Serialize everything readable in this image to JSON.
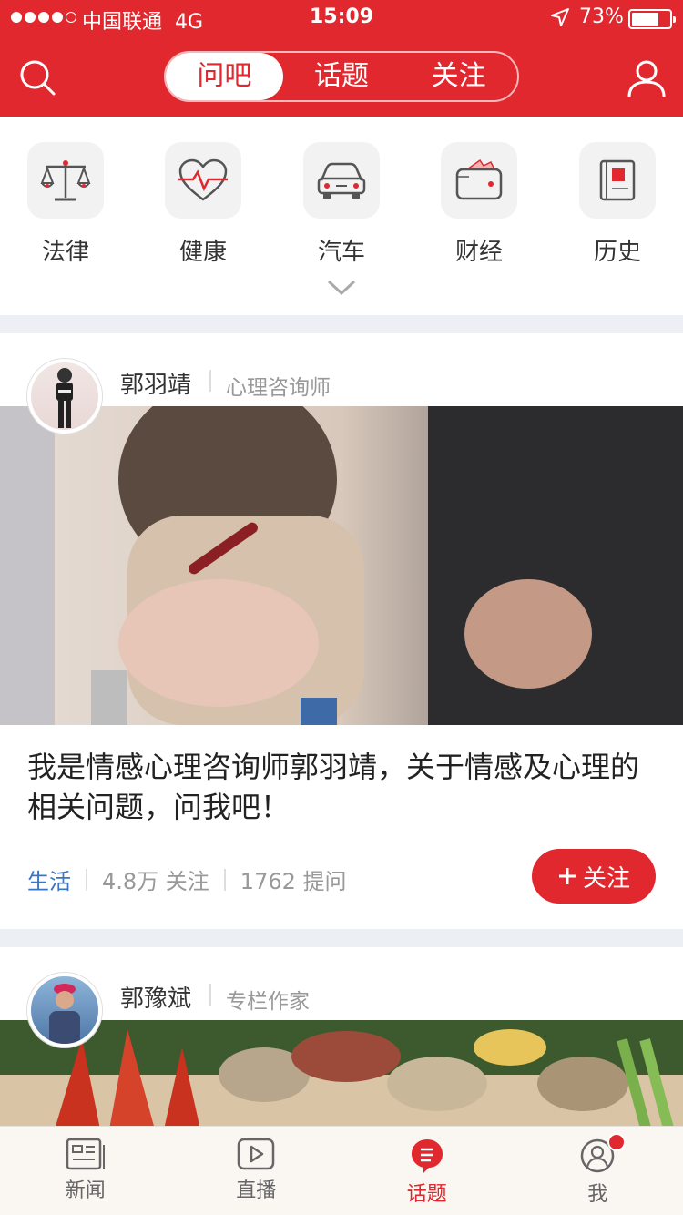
{
  "status": {
    "carrier": "中国联通",
    "network": "4G",
    "time": "15:09",
    "battery": "73%",
    "battery_level": 0.73
  },
  "nav": {
    "tabs": [
      {
        "label": "问吧",
        "active": true
      },
      {
        "label": "话题",
        "active": false
      },
      {
        "label": "关注",
        "active": false
      }
    ]
  },
  "categories": [
    {
      "label": "法律",
      "icon": "scales-icon"
    },
    {
      "label": "健康",
      "icon": "heart-pulse-icon"
    },
    {
      "label": "汽车",
      "icon": "car-icon"
    },
    {
      "label": "财经",
      "icon": "wallet-icon"
    },
    {
      "label": "历史",
      "icon": "book-icon"
    }
  ],
  "cards": [
    {
      "name": "郭羽靖",
      "role": "心理咨询师",
      "title": "我是情感心理咨询师郭羽靖，关于情感及心理的相关问题，问我吧！",
      "tag": "生活",
      "followers": "4.8万 关注",
      "questions": "1762 提问",
      "follow_label": "关注"
    },
    {
      "name": "郭豫斌",
      "role": "专栏作家"
    }
  ],
  "tabbar": [
    {
      "label": "新闻",
      "icon": "newspaper-icon",
      "active": false
    },
    {
      "label": "直播",
      "icon": "play-icon",
      "active": false
    },
    {
      "label": "话题",
      "icon": "chat-icon",
      "active": true
    },
    {
      "label": "我",
      "icon": "profile-icon",
      "active": false
    }
  ],
  "colors": {
    "accent": "#e0282e",
    "tag": "#3a76c4"
  }
}
